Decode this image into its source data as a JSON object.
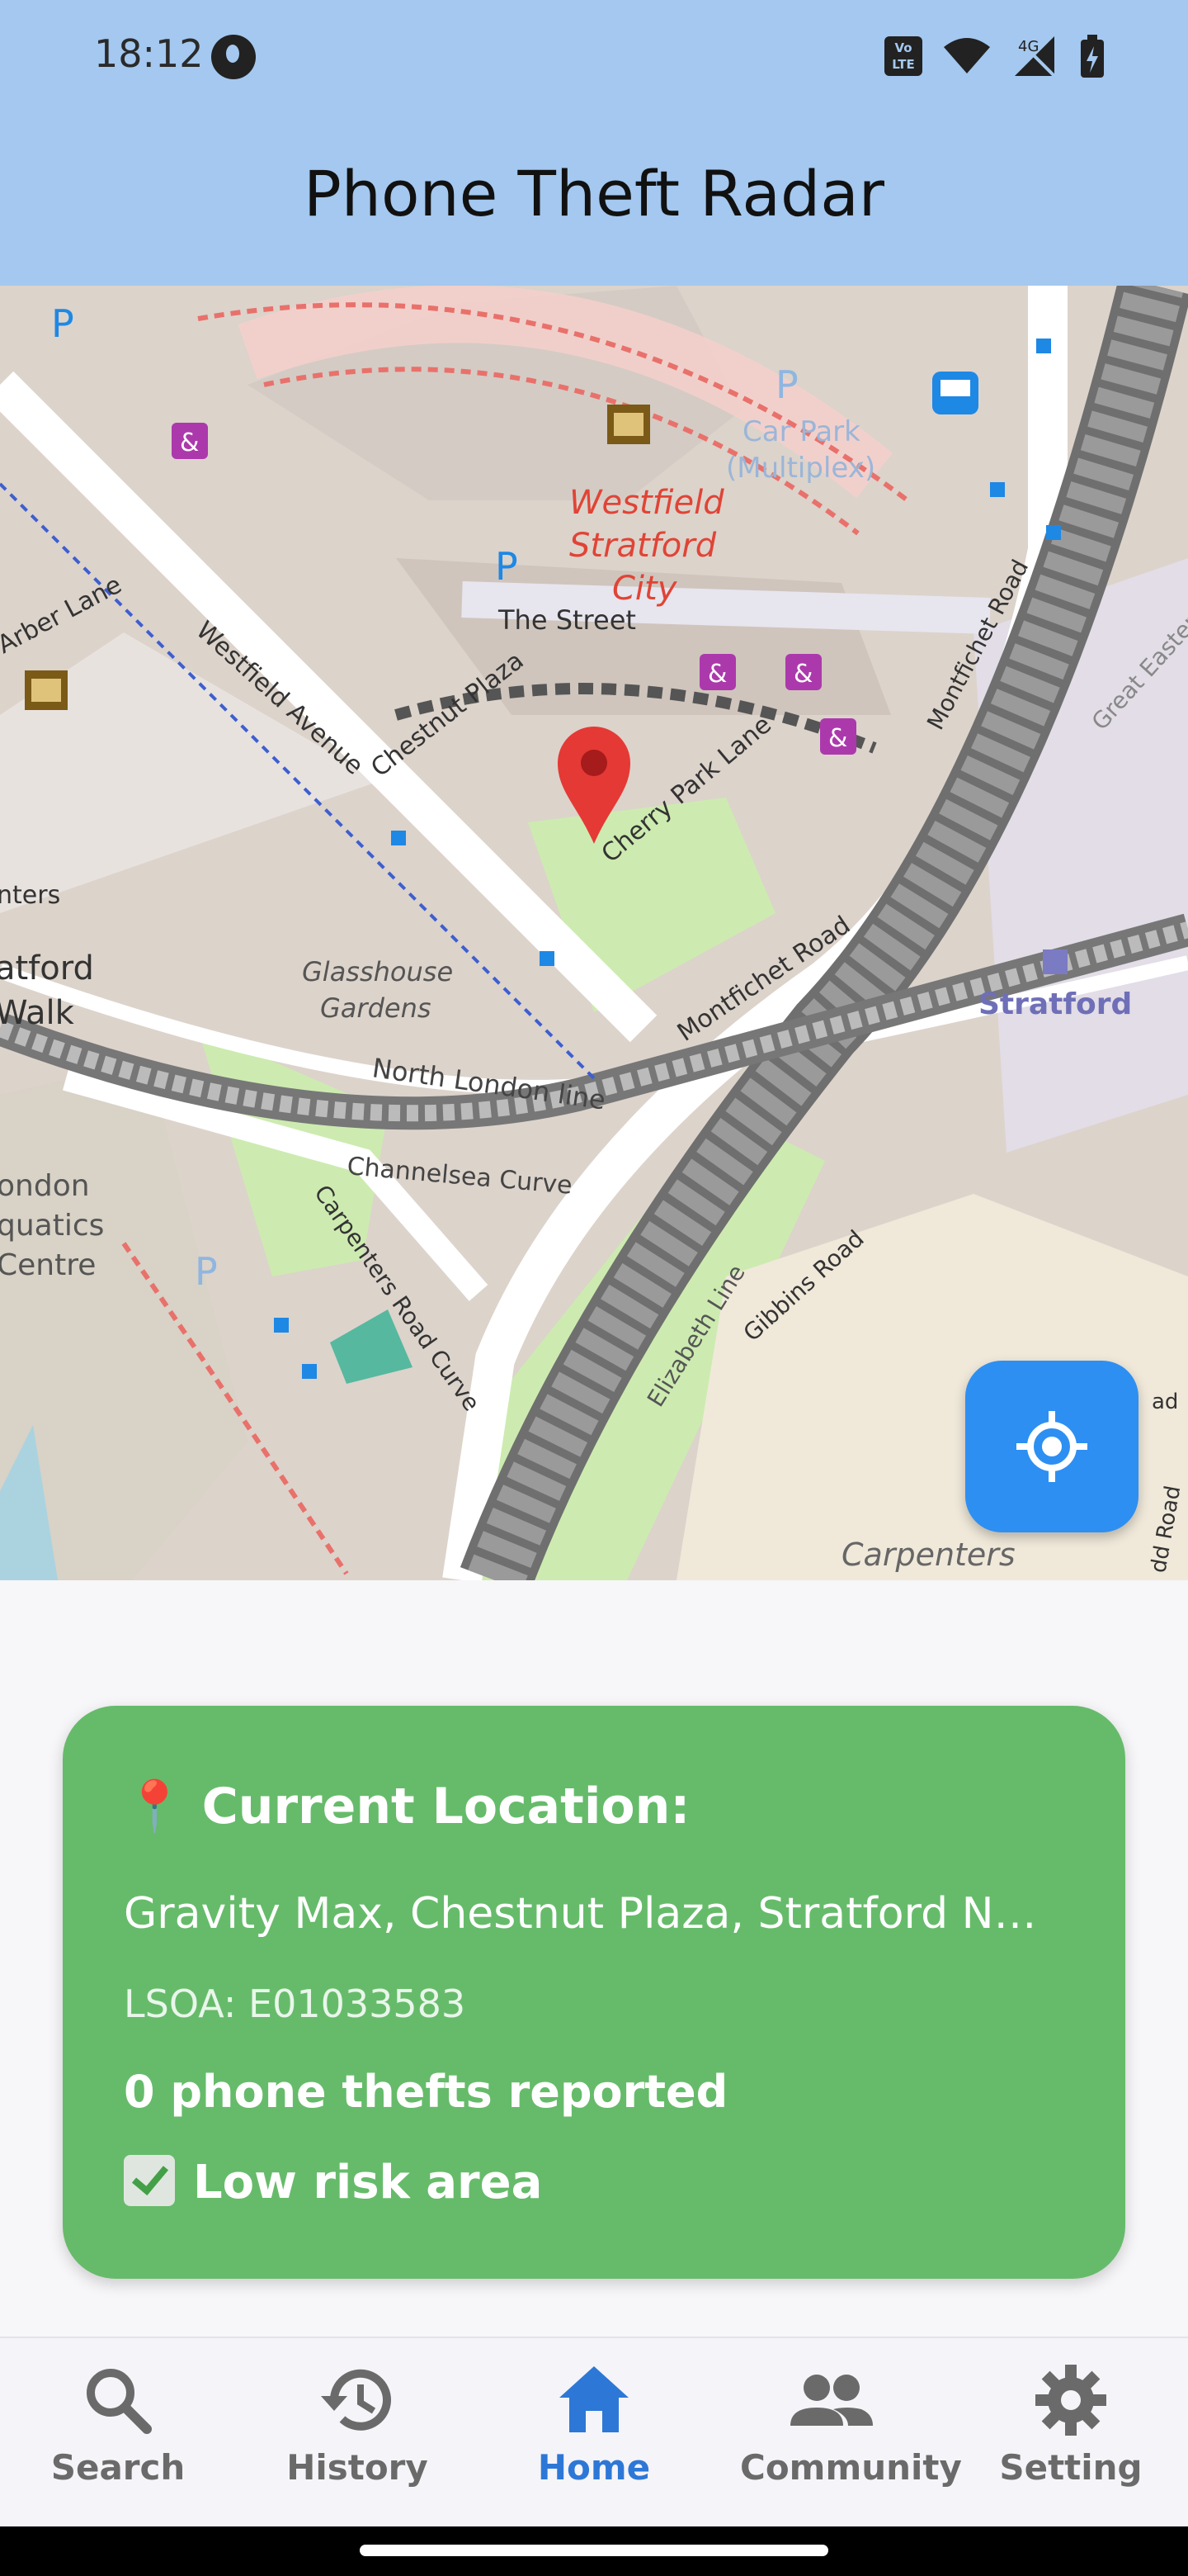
{
  "status_bar": {
    "time": "18:12",
    "network": "4G"
  },
  "app_bar": {
    "title": "Phone Theft Radar"
  },
  "map": {
    "labels": {
      "westfield_1": "Westfield",
      "westfield_2": "Stratford",
      "westfield_3": "City",
      "car_park_1": "Car Park",
      "car_park_2": "(Multiplex)",
      "the_street": "The Street",
      "arber_lane": "Arber Lane",
      "westfield_avenue": "Westfield Avenue",
      "chestnut_plaza": "Chestnut Plaza",
      "cherry_park_lane": "Cherry Park Lane",
      "montfichet_road_top": "Montfichet Road",
      "montfichet_road": "Montfichet Road",
      "glasshouse_1": "Glasshouse",
      "glasshouse_2": "Gardens",
      "north_london_line": "North London line",
      "channelsea_curve": "Channelsea Curve",
      "carpenters_road_curve": "Carpenters Road Curve",
      "elizabeth_line": "Elizabeth Line",
      "gibbins_road": "Gibbins Road",
      "stratford": "Stratford",
      "carpenters": "Carpenters",
      "stratford_walk_1": "atford",
      "stratford_walk_2": "Walk",
      "aquatics_1": "ondon",
      "aquatics_2": "quatics",
      "aquatics_3": "Centre",
      "glade_east": "Great Eastern",
      "enters": "nters",
      "ad_1": "ad",
      "road_partial": "ad",
      "dd_road": "dd Road"
    }
  },
  "card": {
    "title": "Current Location:",
    "address": "Gravity Max, Chestnut Plaza, Stratford Ne...",
    "lsoa": "LSOA: E01033583",
    "thefts": "0 phone thefts reported",
    "risk": "Low risk area",
    "pin_glyph": "📍",
    "background": "#66bb6a"
  },
  "nav": {
    "items": [
      {
        "label": "Search",
        "icon": "search-icon"
      },
      {
        "label": "History",
        "icon": "history-icon"
      },
      {
        "label": "Home",
        "icon": "home-icon"
      },
      {
        "label": "Community",
        "icon": "community-icon"
      },
      {
        "label": "Setting",
        "icon": "gear-icon"
      }
    ],
    "active": "Home",
    "active_color": "#2d78d6"
  }
}
